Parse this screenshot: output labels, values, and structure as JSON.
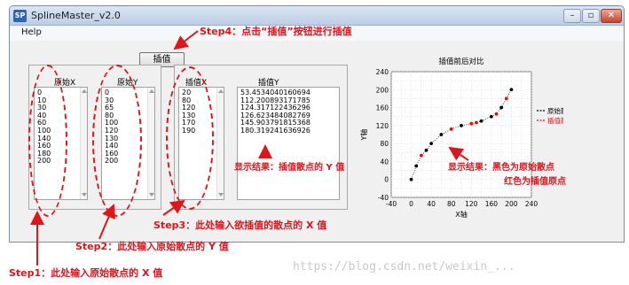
{
  "window": {
    "app_icon": "SP",
    "title": "SplineMaster_v2.0",
    "min_glyph": "–",
    "max_glyph": "▫",
    "close_glyph": "✕"
  },
  "menu": {
    "help": "Help"
  },
  "interp_button": "插值",
  "columns": {
    "x_label": "原始X",
    "y_label": "原始Y",
    "ix_label": "插值X",
    "iy_label": "插值Y",
    "x_values": "0\n10\n30\n40\n60\n100\n140\n160\n180\n200",
    "y_values": "0\n30\n65\n80\n100\n120\n130\n140\n160\n200",
    "ix_values": "20\n80\n120\n130\n170\n190",
    "iy_values": "53.4534040160694\n112.200893171785\n124.317122436296\n126.623484082769\n145.903791815368\n180.319241636926"
  },
  "annotations": {
    "step1": "Step1：此处输入原始散点的 X 值",
    "step2": "Step2：此处输入原始散点的 Y 值",
    "step3": "Step3：此处输入欲插值的散点的 X 值",
    "step4": "Step4：点击“插值”按钮进行插值",
    "result_mid": "显示结果：插值散点的 Y 值",
    "result_chart_line1": "显示结果：黑色为原始散点",
    "result_chart_line2": "红色为插值原点"
  },
  "colors": {
    "annotation": "#e0141b",
    "original": "#000000",
    "interpolated": "#ff0000"
  },
  "watermark": "https://blog.csdn.net/weixin_...",
  "chart_data": {
    "type": "scatter",
    "title": "插值前后对比",
    "xlabel": "X轴",
    "ylabel": "Y轴",
    "xlim": [
      -40,
      240
    ],
    "ylim": [
      -40,
      240
    ],
    "xticks": [
      -40,
      -20,
      0,
      20,
      40,
      60,
      80,
      100,
      120,
      140,
      160,
      180,
      200,
      220,
      240
    ],
    "yticks": [
      -40,
      -20,
      0,
      20,
      40,
      60,
      80,
      100,
      120,
      140,
      160,
      180,
      200,
      220,
      240
    ],
    "grid": true,
    "legend_position": "right",
    "series": [
      {
        "name": "原始散点",
        "color": "#000000",
        "x": [
          0,
          10,
          30,
          40,
          60,
          100,
          140,
          160,
          180,
          200
        ],
        "y": [
          0,
          30,
          65,
          80,
          100,
          120,
          130,
          140,
          160,
          200
        ]
      },
      {
        "name": "插值散点",
        "color": "#ff0000",
        "x": [
          20,
          80,
          120,
          130,
          170,
          190
        ],
        "y": [
          53.45,
          112.2,
          124.32,
          126.62,
          145.9,
          180.32
        ]
      }
    ]
  }
}
